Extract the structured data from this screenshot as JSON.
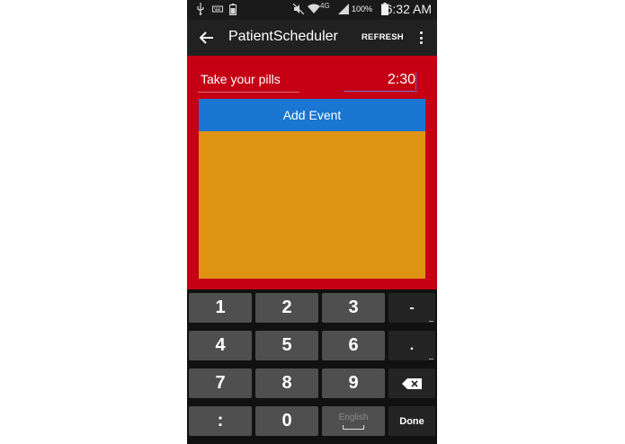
{
  "status_bar": {
    "battery_percent": "100%",
    "network_label": "4G",
    "time": "6:32 AM"
  },
  "action_bar": {
    "title": "PatientScheduler",
    "refresh_label": "REFRESH",
    "back_icon": "arrow-left-icon",
    "overflow_icon": "more-vert-icon"
  },
  "form": {
    "event_text": "Take your pills",
    "time_value": "2:30",
    "add_button_label": "Add Event"
  },
  "colors": {
    "background": "#c50014",
    "action_bar": "#212121",
    "add_button": "#1976d2",
    "event_list": "#de9412"
  },
  "keyboard": {
    "rows": [
      [
        "1",
        "2",
        "3",
        "-"
      ],
      [
        "4",
        "5",
        "6",
        "."
      ],
      [
        "7",
        "8",
        "9",
        "backspace"
      ],
      [
        ":",
        "0",
        "English",
        "Done"
      ]
    ],
    "space_label": "English",
    "done_label": "Done"
  }
}
